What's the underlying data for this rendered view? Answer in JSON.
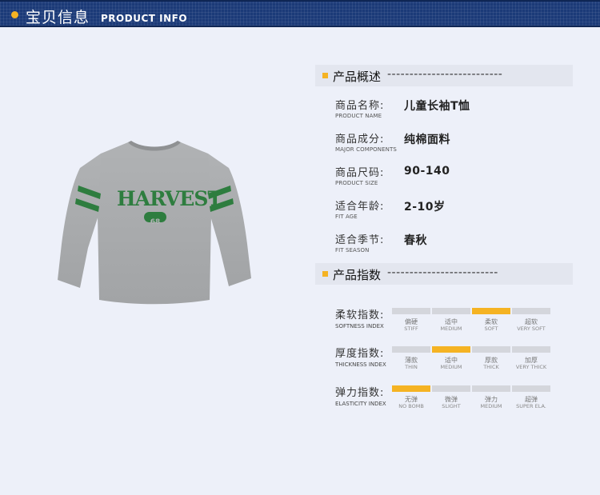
{
  "header": {
    "title_cn": "宝贝信息",
    "title_en": "PRODUCT INFO"
  },
  "product_image": {
    "print_text": "HARVEST",
    "print_number": "68"
  },
  "overview": {
    "title": "产品概述",
    "dashes": "--------------------------",
    "rows": [
      {
        "label_cn": "商品名称:",
        "label_en": "PRODUCT NAME",
        "value": "儿童长袖T恤"
      },
      {
        "label_cn": "商品成分:",
        "label_en": "MAJOR COMPONENTS",
        "value": "纯棉面料"
      },
      {
        "label_cn": "商品尺码:",
        "label_en": "PRODUCT SIZE",
        "value": "90-140"
      },
      {
        "label_cn": "适合年龄:",
        "label_en": "FIT AGE",
        "value": "2-10岁"
      },
      {
        "label_cn": "适合季节:",
        "label_en": "FIT SEASON",
        "value": "春秋"
      }
    ]
  },
  "index": {
    "title": "产品指数",
    "dashes": "-------------------------",
    "rows": [
      {
        "label_cn": "柔软指数:",
        "label_en": "SOFTNESS INDEX",
        "active": 2,
        "options": [
          {
            "cn": "偏硬",
            "en": "STIFF"
          },
          {
            "cn": "适中",
            "en": "MEDIUM"
          },
          {
            "cn": "柔软",
            "en": "SOFT"
          },
          {
            "cn": "超软",
            "en": "VERY SOFT"
          }
        ]
      },
      {
        "label_cn": "厚度指数:",
        "label_en": "THICKNESS INDEX",
        "active": 1,
        "options": [
          {
            "cn": "薄款",
            "en": "THIN"
          },
          {
            "cn": "适中",
            "en": "MEDIUM"
          },
          {
            "cn": "厚款",
            "en": "THICK"
          },
          {
            "cn": "加厚",
            "en": "VERY THICK"
          }
        ]
      },
      {
        "label_cn": "弹力指数:",
        "label_en": "ELASTICITY INDEX",
        "active": 0,
        "options": [
          {
            "cn": "无弹",
            "en": "NO BOMB"
          },
          {
            "cn": "微弹",
            "en": "SLIGHT"
          },
          {
            "cn": "弹力",
            "en": "MEDIUM"
          },
          {
            "cn": "超弹",
            "en": "SUPER ELA."
          }
        ]
      }
    ]
  },
  "colors": {
    "accent": "#f5b323",
    "header_bg": "#1b3a78",
    "shirt_gray": "#a9abad",
    "stripe_green": "#2e7d3f"
  }
}
